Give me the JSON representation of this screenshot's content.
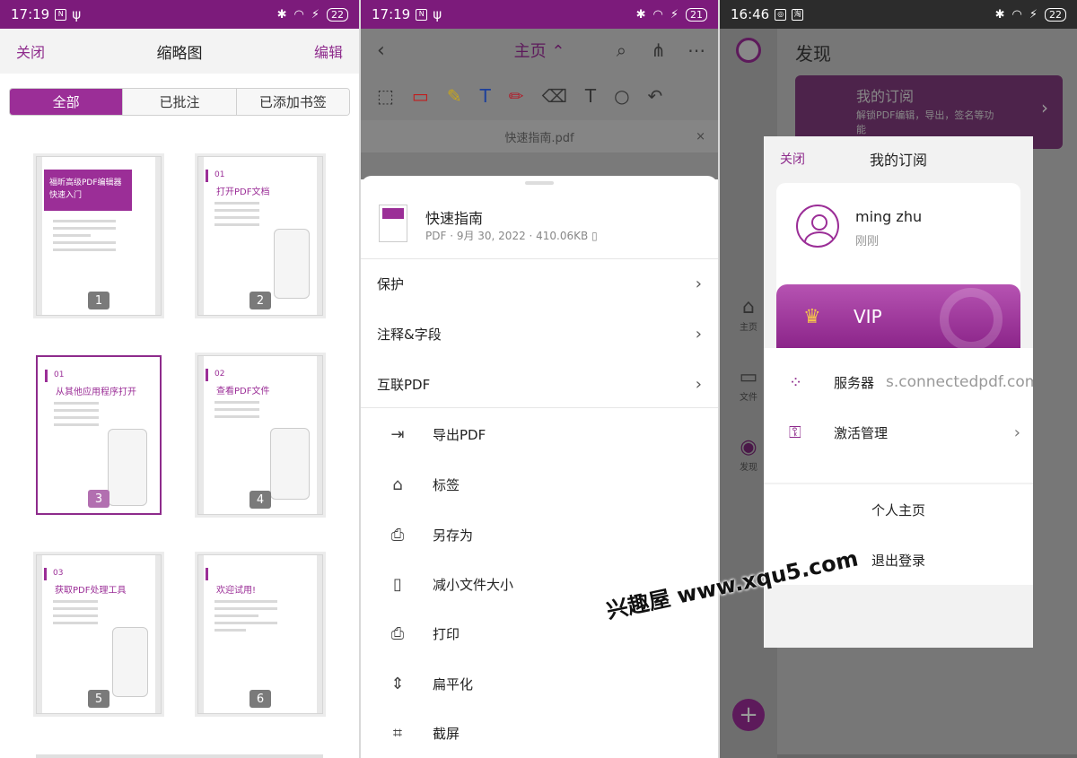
{
  "phone1": {
    "status": {
      "time": "17:19",
      "battery": "22"
    },
    "header": {
      "close": "关闭",
      "title": "缩略图",
      "edit": "编辑"
    },
    "segments": [
      "全部",
      "已批注",
      "已添加书签"
    ],
    "pages": [
      {
        "num": "1",
        "cover": "福昕高级PDF编辑器\n快速入门"
      },
      {
        "num": "2",
        "tag": "01",
        "title": "打开PDF文档"
      },
      {
        "num": "3",
        "tag": "01",
        "title": "从其他应用程序打开"
      },
      {
        "num": "4",
        "tag": "02",
        "title": "查看PDF文件"
      },
      {
        "num": "5",
        "tag": "03",
        "title": "获取PDF处理工具"
      },
      {
        "num": "6",
        "title": "欢迎试用!"
      }
    ]
  },
  "phone2": {
    "status": {
      "time": "17:19",
      "battery": "21"
    },
    "header": {
      "title": "主页 ⌃"
    },
    "tab": {
      "label": "快速指南.pdf"
    },
    "file": {
      "name": "快速指南",
      "meta": "PDF · 9月 30, 2022 · 410.06KB"
    },
    "sections": [
      "保护",
      "注释&字段",
      "互联PDF"
    ],
    "actions": [
      {
        "label": "导出PDF",
        "icon": "export-icon"
      },
      {
        "label": "标签",
        "icon": "tag-icon"
      },
      {
        "label": "另存为",
        "icon": "save-as-icon"
      },
      {
        "label": "减小文件大小",
        "icon": "compress-icon"
      },
      {
        "label": "打印",
        "icon": "print-icon"
      },
      {
        "label": "扁平化",
        "icon": "flatten-icon"
      },
      {
        "label": "截屏",
        "icon": "crop-icon"
      }
    ]
  },
  "phone3": {
    "status": {
      "time": "16:46",
      "battery": "22"
    },
    "page_title": "发现",
    "subscription": {
      "title": "我的订阅",
      "desc": "解锁PDF编辑，导出，签名等功能"
    },
    "nav": [
      {
        "label": "主页"
      },
      {
        "label": "文件"
      },
      {
        "label": "发现"
      }
    ],
    "modal": {
      "close": "关闭",
      "title": "我的订阅",
      "user": {
        "name": "ming zhu",
        "time": "刚刚"
      },
      "vip": "VIP",
      "server": {
        "label": "服务器",
        "value": "s.connectedpdf.com"
      },
      "activation": "激活管理",
      "profile": "个人主页",
      "logout": "退出登录"
    }
  },
  "watermark": "兴趣屋 www.xqu5.com"
}
